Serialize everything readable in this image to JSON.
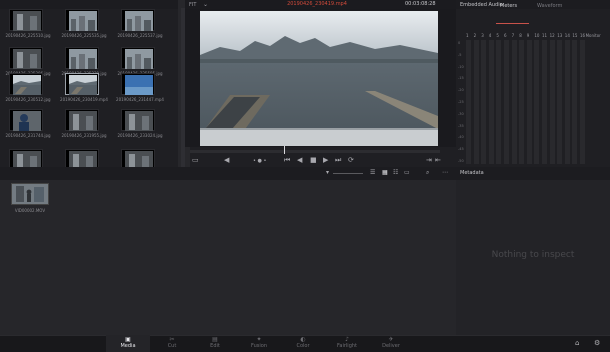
{
  "media_pool": {
    "clips": [
      {
        "name": "20190426_225510.jpg",
        "kind": "street"
      },
      {
        "name": "20190426_225535.jpg",
        "kind": "city"
      },
      {
        "name": "20190426_225537.jpg",
        "kind": "city"
      },
      {
        "name": "20190426_225206.jpg",
        "kind": "street"
      },
      {
        "name": "20190426_225239.jpg",
        "kind": "city"
      },
      {
        "name": "20190426_225595.jpg",
        "kind": "city"
      },
      {
        "name": "20190426_230512.jpg",
        "kind": "harbor"
      },
      {
        "name": "20190426_230419.mp4",
        "kind": "harbor",
        "selected": true
      },
      {
        "name": "20190426_231447.mp4",
        "kind": "water"
      },
      {
        "name": "20190426_231744.jpg",
        "kind": "person"
      },
      {
        "name": "20190426_231955.jpg",
        "kind": "street"
      },
      {
        "name": "20190426_233024.jpg",
        "kind": "street"
      },
      {
        "name": "",
        "kind": "street"
      },
      {
        "name": "",
        "kind": "street"
      },
      {
        "name": "",
        "kind": "street"
      }
    ]
  },
  "viewer": {
    "zoom": "FIT",
    "title": "20190426_230419.mp4",
    "timecode": "00:03:08:28"
  },
  "audio": {
    "title": "Embedded Audio",
    "tabs": [
      "Meters",
      "Waveform"
    ],
    "channels": [
      "1",
      "2",
      "3",
      "4",
      "5",
      "6",
      "7",
      "8",
      "9",
      "10",
      "11",
      "12",
      "13",
      "14",
      "15",
      "16",
      "Monitor"
    ],
    "db_scale": [
      "0",
      "-5",
      "-10",
      "-15",
      "-20",
      "-25",
      "-30",
      "-35",
      "-40",
      "-45",
      "-50"
    ]
  },
  "bin": {
    "clip_name": "VID00002.MOV"
  },
  "metadata": {
    "title": "Metadata",
    "empty_text": "Nothing to inspect"
  },
  "pages": [
    {
      "label": "Media",
      "icon": "media-icon",
      "active": true
    },
    {
      "label": "Cut",
      "icon": "cut-icon"
    },
    {
      "label": "Edit",
      "icon": "edit-icon"
    },
    {
      "label": "Fusion",
      "icon": "fusion-icon"
    },
    {
      "label": "Color",
      "icon": "color-icon"
    },
    {
      "label": "Fairlight",
      "icon": "fairlight-icon"
    },
    {
      "label": "Deliver",
      "icon": "deliver-icon"
    }
  ]
}
